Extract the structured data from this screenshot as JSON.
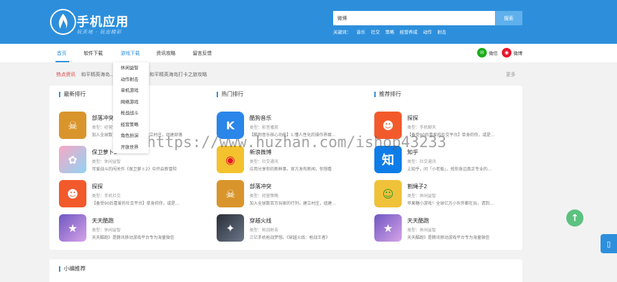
{
  "header": {
    "title": "手机应用",
    "slogan": "玩天地 · 玩出精彩",
    "search": {
      "value": "微博",
      "button": "搜索"
    },
    "keywords_label": "关键词：",
    "keywords": [
      "音乐",
      "社交",
      "策略",
      "经营养成",
      "动作",
      "射击"
    ]
  },
  "nav": {
    "items": [
      "首页",
      "软件下载",
      "游戏下载",
      "资讯攻略",
      "留言反馈"
    ],
    "active": "游戏下载",
    "share": [
      {
        "label": "微信",
        "icon": "wechat-icon",
        "color": "#1aad19"
      },
      {
        "label": "微博",
        "icon": "weibo-icon",
        "color": "#e6162d"
      }
    ]
  },
  "dropdown": [
    "休闲益智",
    "动作射击",
    "单机游戏",
    "网络游戏",
    "枪战战斗",
    "经营策略",
    "角色扮演",
    "开放世界"
  ],
  "hot": {
    "label": "热点资讯",
    "text1": "和平精英海岛...",
    "text2": "和平精英海岛打卡之旅攻略",
    "more": "更多"
  },
  "columns": [
    {
      "title": "最新排行",
      "apps": [
        {
          "name": "部落冲突",
          "type": "类型：经营策略",
          "desc": "加入全球数百万玩家的行列，建立村庄，组建部落",
          "icon": "clash-icon",
          "color": "#d9952c",
          "glyph": "☠"
        },
        {
          "name": "保卫萝卜2",
          "type": "类型：休闲益智",
          "desc": "可爱战斗的闯关作《保卫萝卜2》中开启新冒险",
          "icon": "carrot-icon",
          "color": "#e86f9a",
          "glyph": "✿"
        },
        {
          "name": "探探",
          "type": "类型：手机社交",
          "desc": "【备受90后喜爱的社交平台】单身的你，或是…",
          "icon": "tantan-icon",
          "color": "#f25a2c",
          "glyph": "☻"
        },
        {
          "name": "天天酷跑",
          "type": "类型：休闲益智",
          "desc": "天天酷跑》是腾讯移动游戏平台专为海量微信",
          "icon": "parkour-icon",
          "color": "#7a5fc8",
          "glyph": "★"
        }
      ]
    },
    {
      "title": "热门排行",
      "apps": [
        {
          "name": "酷狗音乐",
          "type": "类型：影音播放",
          "desc": "【酷狗音乐核心功能】1.懂人性化的操作界面…",
          "icon": "kugou-icon",
          "color": "#2a86e8",
          "glyph": "K"
        },
        {
          "name": "新浪微博",
          "type": "类型：社交通讯",
          "desc": "应用分享你的新鲜事，官方发布新闻，你想看",
          "icon": "weibo-app-icon",
          "color": "#f4c22e",
          "glyph": "◉"
        },
        {
          "name": "部落冲突",
          "type": "类型：经营策略",
          "desc": "加入全球数百万玩家的行列，建立村庄，组建…",
          "icon": "clash-icon",
          "color": "#d9952c",
          "glyph": "☠"
        },
        {
          "name": "穿越火线",
          "type": "类型：枪战射击",
          "desc": "三亿手机枪战梦想。《穿越火线：枪战王者》",
          "icon": "cf-icon",
          "color": "#3a3f4a",
          "glyph": "✦"
        }
      ]
    },
    {
      "title": "推荐排行",
      "apps": [
        {
          "name": "探探",
          "type": "类型：手机聊天",
          "desc": "【备受90后喜爱的社交平台】单身的你，或是…",
          "icon": "tantan-icon",
          "color": "#f25a2c",
          "glyph": "☻"
        },
        {
          "name": "知乎",
          "type": "类型：社交通讯",
          "desc": "上知乎，问「小老板」，找你身边真正专业的…",
          "icon": "zhihu-icon",
          "color": "#0f7de8",
          "glyph": "知"
        },
        {
          "name": "割绳子2",
          "type": "类型：休闲益智",
          "desc": "苹果糖小游戏！全球亿万小伙伴都在玩，请到…",
          "icon": "cut-rope-icon",
          "color": "#f0c23a",
          "glyph": "☺"
        },
        {
          "name": "天天酷跑",
          "type": "类型：休闲益智",
          "desc": "天天酷跑》是腾讯移动游戏平台专为海量微信",
          "icon": "parkour-icon",
          "color": "#7a5fc8",
          "glyph": "★"
        }
      ]
    }
  ],
  "bottom_panel": {
    "title": "小编推荐"
  },
  "watermark": "https://www.huzhan.com/ishop43233",
  "floating": {
    "to_top": "↑",
    "phone": "▯"
  }
}
